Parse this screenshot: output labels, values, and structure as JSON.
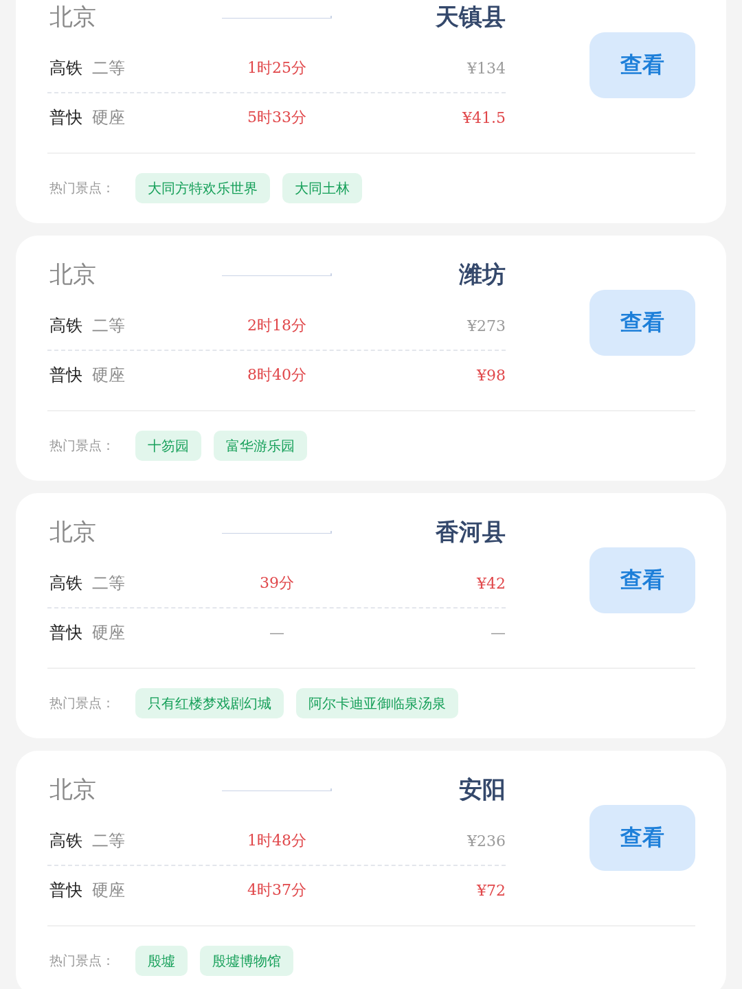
{
  "cards": [
    {
      "from": "北京",
      "to": "天镇县",
      "button": "查看",
      "spots_label": "热门景点：",
      "trains": [
        {
          "type": "高铁",
          "seat": "二等",
          "duration": "1时25分",
          "price": "¥134",
          "available": true,
          "highlight": false
        },
        {
          "type": "普快",
          "seat": "硬座",
          "duration": "5时33分",
          "price": "¥41.5",
          "available": true,
          "highlight": true
        }
      ],
      "spots": [
        "大同方特欢乐世界",
        "大同土林"
      ]
    },
    {
      "from": "北京",
      "to": "潍坊",
      "button": "查看",
      "spots_label": "热门景点：",
      "trains": [
        {
          "type": "高铁",
          "seat": "二等",
          "duration": "2时18分",
          "price": "¥273",
          "available": true,
          "highlight": false
        },
        {
          "type": "普快",
          "seat": "硬座",
          "duration": "8时40分",
          "price": "¥98",
          "available": true,
          "highlight": true
        }
      ],
      "spots": [
        "十笏园",
        "富华游乐园"
      ]
    },
    {
      "from": "北京",
      "to": "香河县",
      "button": "查看",
      "spots_label": "热门景点：",
      "trains": [
        {
          "type": "高铁",
          "seat": "二等",
          "duration": "39分",
          "price": "¥42",
          "available": true,
          "highlight": true
        },
        {
          "type": "普快",
          "seat": "硬座",
          "duration": "—",
          "price": "—",
          "available": false,
          "highlight": false
        }
      ],
      "spots": [
        "只有红楼梦戏剧幻城",
        "阿尔卡迪亚御临泉汤泉"
      ]
    },
    {
      "from": "北京",
      "to": "安阳",
      "button": "查看",
      "spots_label": "热门景点：",
      "trains": [
        {
          "type": "高铁",
          "seat": "二等",
          "duration": "1时48分",
          "price": "¥236",
          "available": true,
          "highlight": false
        },
        {
          "type": "普快",
          "seat": "硬座",
          "duration": "4时37分",
          "price": "¥72",
          "available": true,
          "highlight": true
        }
      ],
      "spots": [
        "殷墟",
        "殷墟博物馆"
      ]
    }
  ]
}
